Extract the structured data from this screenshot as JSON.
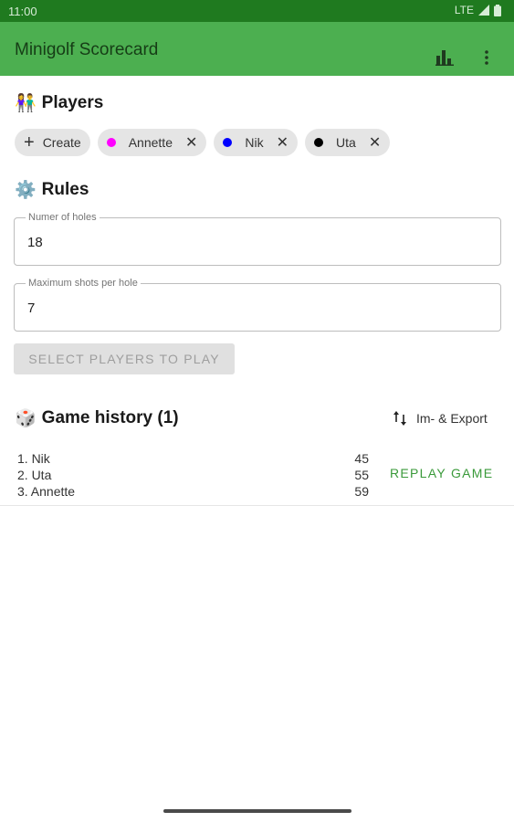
{
  "status_bar": {
    "time": "11:00",
    "network": "LTE"
  },
  "app_bar": {
    "title": "Minigolf Scorecard",
    "icons": [
      "bar-chart-icon",
      "more-vert-icon"
    ]
  },
  "players": {
    "title": "Players",
    "emoji": "👫",
    "create_label": "Create",
    "chips": [
      {
        "name": "Annette",
        "color": "#ff00ff"
      },
      {
        "name": "Nik",
        "color": "#0000ff"
      },
      {
        "name": "Uta",
        "color": "#000000"
      }
    ]
  },
  "rules": {
    "title": "Rules",
    "emoji": "⚙️",
    "holes": {
      "label": "Numer of holes",
      "value": "18"
    },
    "max_shots": {
      "label": "Maximum shots per hole",
      "value": "7"
    },
    "start_label": "SELECT PLAYERS TO PLAY"
  },
  "history": {
    "title": "Game history (1)",
    "emoji": "🎲",
    "export_label": "Im- & Export",
    "games": [
      {
        "ranking": [
          "1. Nik",
          "2. Uta",
          "3. Annette"
        ],
        "scores": [
          "45",
          "55",
          "59"
        ],
        "replay_label": "REPLAY GAME"
      }
    ]
  },
  "colors": {
    "app_bar": "#4caf50",
    "status_bar": "#1f7a1f",
    "accent": "#3a9a3a"
  }
}
